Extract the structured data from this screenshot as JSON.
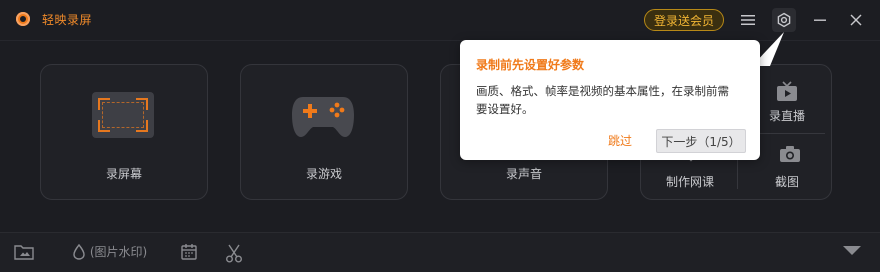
{
  "app": {
    "title": "轻映录屏",
    "login_button": "登录送会员"
  },
  "icons": {
    "logo": "record-logo-icon",
    "menu": "hamburger-menu-icon",
    "settings": "settings-hex-icon",
    "minimize": "minimize-icon",
    "close": "close-icon"
  },
  "modes": {
    "record_screen": "录屏幕",
    "record_game": "录游戏",
    "record_audio": "录声音",
    "record_live": "录直播",
    "make_course": "制作网课",
    "screenshot": "截图"
  },
  "bottom": {
    "watermark_label": "(图片水印)"
  },
  "tooltip": {
    "title": "录制前先设置好参数",
    "body": "画质、格式、帧率是视频的基本属性，在录制前需要设置好。",
    "skip": "跳过",
    "next": "下一步（1/5）"
  },
  "colors": {
    "accent": "#f07a1a",
    "background": "#1c1d22",
    "card": "#202126",
    "gold": "#f1b534"
  }
}
